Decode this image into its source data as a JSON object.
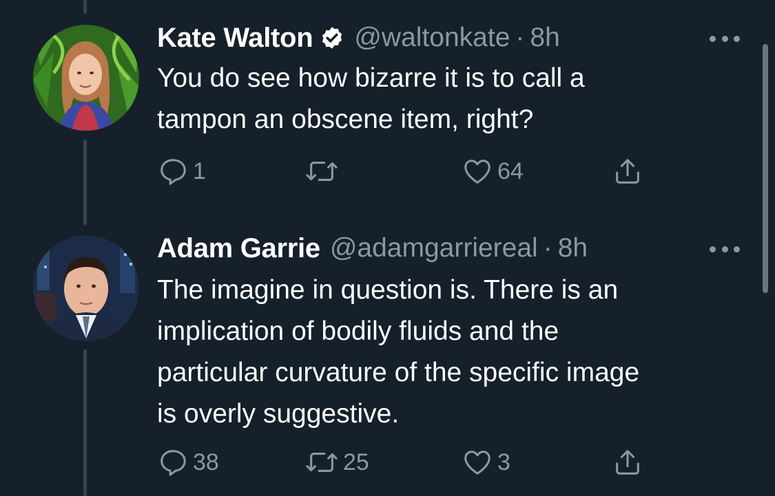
{
  "theme": {
    "background": "#15202b",
    "text": "#ffffff",
    "muted": "#8899a6",
    "thread_line": "#38444d"
  },
  "tweets": [
    {
      "name": "Kate Walton",
      "verified": true,
      "handle": "@waltonkate",
      "separator": "·",
      "time": "8h",
      "text_lines": [
        "You do see how bizarre it is to call a",
        "tampon an obscene item, right?"
      ],
      "replies": "1",
      "retweets": "",
      "likes": "64",
      "icons": [
        "reply-icon",
        "retweet-icon",
        "like-icon",
        "share-icon",
        "more-icon",
        "verified-badge-icon"
      ]
    },
    {
      "name": "Adam Garrie",
      "verified": false,
      "handle": "@adamgarriereal",
      "separator": "·",
      "time": "8h",
      "text_lines": [
        "The imagine in question is. There is an",
        "implication of bodily fluids and the",
        "particular curvature of the specific image",
        "is overly suggestive."
      ],
      "replies": "38",
      "retweets": "25",
      "likes": "3",
      "icons": [
        "reply-icon",
        "retweet-icon",
        "like-icon",
        "share-icon",
        "more-icon"
      ]
    }
  ]
}
